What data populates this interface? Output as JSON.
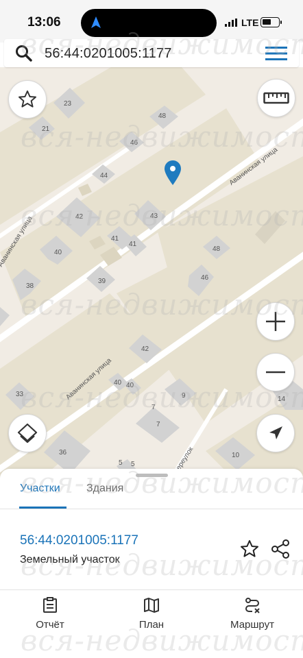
{
  "status": {
    "time": "13:06",
    "network": "LTE",
    "location_icon": "location-arrow-icon"
  },
  "search": {
    "query": "56:44:0201005:1177",
    "icon": "search-icon",
    "menu_icon": "hamburger-menu-icon"
  },
  "map": {
    "house_numbers": [
      "23",
      "21",
      "48",
      "46",
      "44",
      "42",
      "43",
      "41",
      "41",
      "40",
      "39",
      "38",
      "48",
      "46",
      "42",
      "40",
      "40",
      "33",
      "9",
      "7",
      "7",
      "36",
      "5",
      "5",
      "10",
      "14"
    ],
    "streets": [
      "Аванинская улица",
      "Аванинская улица",
      "Аванинская улица",
      "переулок"
    ],
    "colors": {
      "background": "#f1ece4",
      "block": "#e7e1cf",
      "building": "#d2d2d2",
      "road": "#ffffff",
      "marker": "#1f7bbf"
    },
    "controls": {
      "favorite_icon": "star-outline-icon",
      "ruler_icon": "ruler-icon",
      "zoom_in_icon": "plus-icon",
      "zoom_out_icon": "minus-icon",
      "layers_icon": "layers-icon",
      "locate_icon": "navigation-arrow-icon"
    }
  },
  "sheet": {
    "tabs": [
      "Участки",
      "Здания"
    ],
    "active_tab": "Участки",
    "parcel_number": "56:44:0201005:1177",
    "parcel_type": "Земельный участок"
  },
  "bottom_nav": {
    "items": [
      {
        "label": "Отчёт",
        "icon": "report-clipboard-icon"
      },
      {
        "label": "План",
        "icon": "map-plan-icon"
      },
      {
        "label": "Маршрут",
        "icon": "route-icon"
      }
    ]
  },
  "watermark": "вся-недвижимость.net",
  "accent_color": "#1a73b8"
}
